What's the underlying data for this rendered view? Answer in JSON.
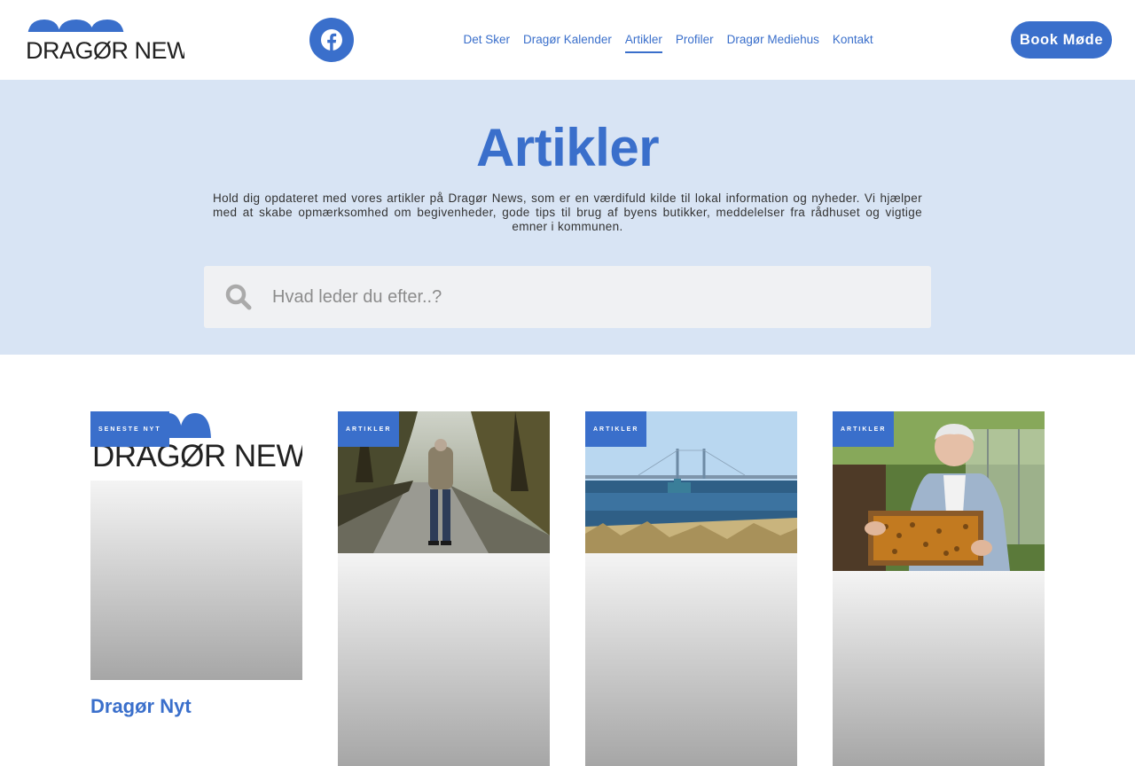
{
  "header": {
    "logo_text": "DRAGØR NEWS",
    "nav": [
      {
        "label": "Det Sker",
        "active": false
      },
      {
        "label": "Dragør Kalender",
        "active": false
      },
      {
        "label": "Artikler",
        "active": true
      },
      {
        "label": "Profiler",
        "active": false
      },
      {
        "label": "Dragør Mediehus",
        "active": false
      },
      {
        "label": "Kontakt",
        "active": false
      }
    ],
    "book_label": "Book Møde"
  },
  "hero": {
    "title": "Artikler",
    "description": "Hold dig opdateret med vores artikler på Dragør News, som er en værdifuld kilde til lokal information og nyheder. Vi hjælper med at skabe opmærksomhed om begivenheder, gode tips til brug af byens butikker, meddelelser fra rådhuset og vigtige emner i kommunen.",
    "search_placeholder": "Hvad leder du efter..?"
  },
  "cards": [
    {
      "tag": "SENESTE NYT",
      "title": "Dragør Nyt",
      "image": "dragor-news-logo"
    },
    {
      "tag": "ARTIKLER",
      "title": "",
      "image": "man-walking-park-path"
    },
    {
      "tag": "ARTIKLER",
      "title": "",
      "image": "oresund-bridge-seascape"
    },
    {
      "tag": "ARTIKLER",
      "title": "",
      "image": "beekeeper-with-honeycomb-frame"
    }
  ],
  "colors": {
    "brand_blue": "#3a6fcb",
    "hero_bg": "#d8e4f4",
    "search_bg": "#f0f1f3"
  },
  "icons": {
    "facebook": "facebook-icon",
    "search": "search-icon"
  }
}
